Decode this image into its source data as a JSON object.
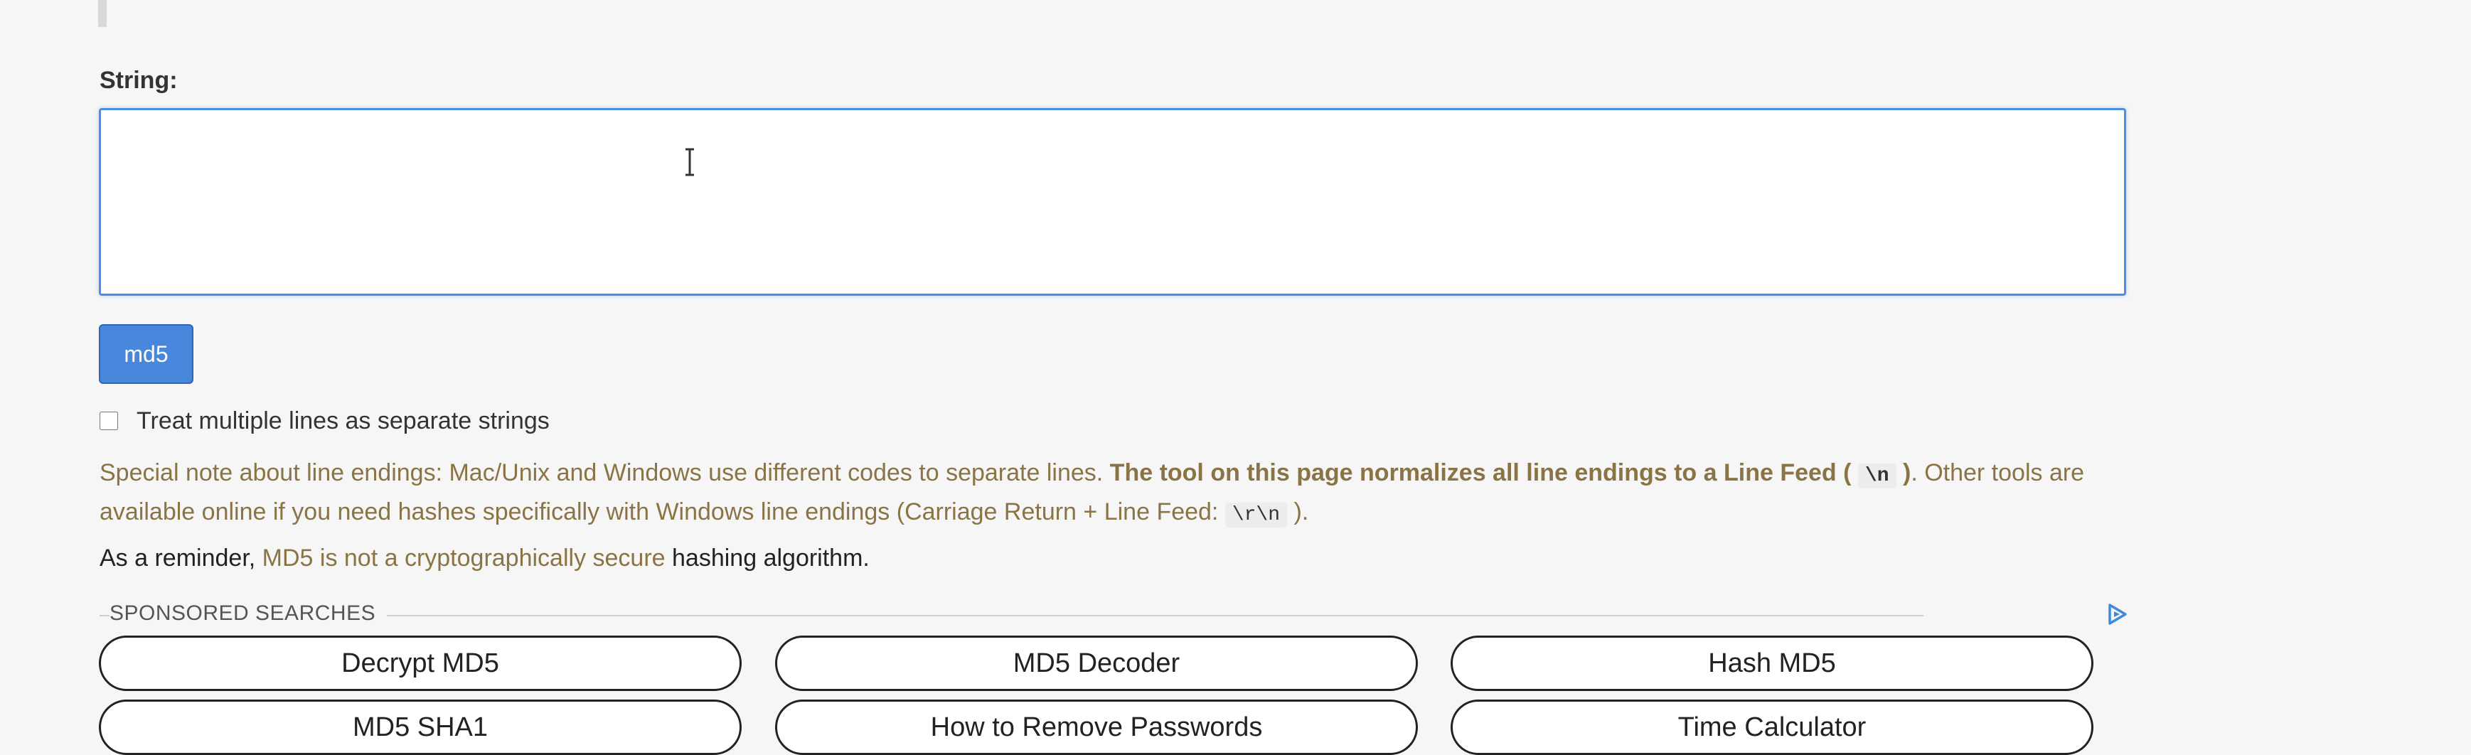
{
  "form": {
    "label": "String:",
    "value": "",
    "button_label": "md5",
    "checkbox_label": "Treat multiple lines as separate strings"
  },
  "note": {
    "lead": "Special note about line endings: Mac/Unix and Windows use different codes to separate lines. ",
    "bold": "The tool on this page normalizes all line endings to a Line Feed ( ",
    "code_lf": "\\n",
    "bold_end": " )",
    "tail": ". Other tools are available online if you need hashes specifically with Windows line endings (Carriage Return + Line Feed: ",
    "code_crlf": "\\r\\n",
    "end": " )."
  },
  "reminder": {
    "prefix": "As a reminder, ",
    "link": "MD5 is not a cryptographically secure",
    "suffix": " hashing algorithm."
  },
  "sponsored": {
    "title": "SPONSORED SEARCHES",
    "items": [
      "Decrypt MD5",
      "MD5 Decoder",
      "Hash MD5",
      "MD5 SHA1",
      "How to Remove Passwords",
      "Time Calculator"
    ]
  },
  "icons": {
    "cursor": "text-cursor-icon",
    "ad": "adchoices-icon"
  },
  "colors": {
    "accent": "#4787dc",
    "link": "#8a7445",
    "focus_border": "#4a90e2"
  }
}
